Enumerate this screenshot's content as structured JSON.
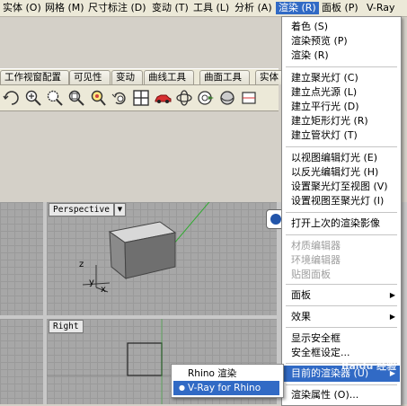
{
  "menubar": {
    "items": [
      {
        "label": "实体 (O)"
      },
      {
        "label": "网格 (M)"
      },
      {
        "label": "尺寸标注 (D)"
      },
      {
        "label": "变动 (T)"
      },
      {
        "label": "工具 (L)"
      },
      {
        "label": "分析 (A)"
      },
      {
        "label": "渲染 (R)"
      },
      {
        "label": "面板 (P)"
      },
      {
        "label": "V-Ray"
      }
    ]
  },
  "tabs": [
    {
      "label": "工作视窗配置"
    },
    {
      "label": "可见性"
    },
    {
      "label": "变动"
    },
    {
      "label": "曲线工具"
    },
    {
      "label": "曲面工具"
    },
    {
      "label": "实体"
    }
  ],
  "toolbar": {
    "icons": [
      "rotate-view-icon",
      "zoom-in-icon",
      "zoom-window-icon",
      "zoom-extents-icon",
      "zoom-selected-icon",
      "undo-view-icon",
      "four-viewports-icon",
      "car-render-icon",
      "rotate-3d-icon",
      "target-icon",
      "sphere-icon"
    ]
  },
  "viewports": {
    "perspective": {
      "label": "Perspective",
      "axis_x": "x",
      "axis_y": "y",
      "axis_z": "z"
    },
    "right": {
      "label": "Right"
    }
  },
  "render_menu": {
    "items": [
      {
        "label": "着色 (S)",
        "disabled": false
      },
      {
        "label": "渲染预览 (P)",
        "disabled": false
      },
      {
        "label": "渲染 (R)",
        "disabled": false
      },
      {
        "label": "建立聚光灯 (C)",
        "disabled": false
      },
      {
        "label": "建立点光源 (L)",
        "disabled": false
      },
      {
        "label": "建立平行光 (D)",
        "disabled": false
      },
      {
        "label": "建立矩形灯光 (R)",
        "disabled": false
      },
      {
        "label": "建立管状灯 (T)",
        "disabled": false
      },
      {
        "label": "以视图编辑灯光 (E)",
        "disabled": false
      },
      {
        "label": "以反光编辑灯光 (H)",
        "disabled": false
      },
      {
        "label": "设置聚光灯至视图 (V)",
        "disabled": false
      },
      {
        "label": "设置视图至聚光灯 (I)",
        "disabled": false
      },
      {
        "label": "打开上次的渲染影像",
        "disabled": false
      },
      {
        "label": "材质编辑器",
        "disabled": true
      },
      {
        "label": "环境编辑器",
        "disabled": true
      },
      {
        "label": "贴图面板",
        "disabled": true
      },
      {
        "label": "面板",
        "disabled": false
      },
      {
        "label": "效果",
        "disabled": false
      },
      {
        "label": "显示安全框",
        "disabled": false
      },
      {
        "label": "安全框设定...",
        "disabled": false
      },
      {
        "label": "目前的渲染器 (U)",
        "disabled": false
      },
      {
        "label": "渲染属性 (O)...",
        "disabled": false
      }
    ]
  },
  "renderer_submenu": {
    "items": [
      {
        "label": "Rhino 渲染",
        "selected": false
      },
      {
        "label": "V-Ray for Rhino",
        "selected": true
      }
    ]
  },
  "watermark": {
    "text": "Baidu 经验"
  },
  "colors": {
    "highlight": "#316ac5",
    "menubar": "#ece9d8",
    "viewport": "#a7a7a7"
  }
}
